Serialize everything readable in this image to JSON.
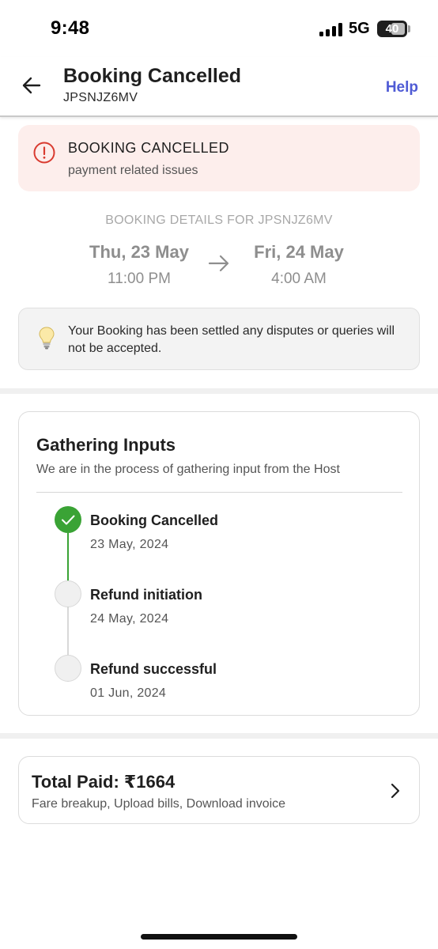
{
  "status_bar": {
    "time": "9:48",
    "network": "5G",
    "battery": "40"
  },
  "header": {
    "title": "Booking Cancelled",
    "booking_id": "JPSNJZ6MV",
    "help_label": "Help",
    "back_icon": "back-arrow-icon"
  },
  "alert": {
    "title": "BOOKING CANCELLED",
    "reason": "payment related issues",
    "icon": "exclamation-circle-icon",
    "color": "#d93b30",
    "background": "#fdeeec"
  },
  "booking_details": {
    "label": "BOOKING DETAILS FOR JPSNJZ6MV",
    "start": {
      "date": "Thu, 23 May",
      "time": "11:00 PM"
    },
    "end": {
      "date": "Fri, 24 May",
      "time": "4:00 AM"
    }
  },
  "notice": {
    "icon": "lightbulb-icon",
    "text": "Your Booking has been settled any disputes or queries will not be accepted."
  },
  "progress": {
    "title": "Gathering Inputs",
    "subtitle": "We are in the process of gathering input from the Host",
    "steps": [
      {
        "label": "Booking Cancelled",
        "date": "23 May, 2024",
        "status": "done"
      },
      {
        "label": "Refund initiation",
        "date": "24 May, 2024",
        "status": "pending"
      },
      {
        "label": "Refund successful",
        "date": "01 Jun, 2024",
        "status": "pending"
      }
    ],
    "done_color": "#3aa335"
  },
  "total": {
    "title": "Total Paid: ₹1664",
    "subtitle": "Fare breakup, Upload bills, Download invoice",
    "icon": "chevron-right-icon"
  },
  "accent_color": "#4f5bd5"
}
